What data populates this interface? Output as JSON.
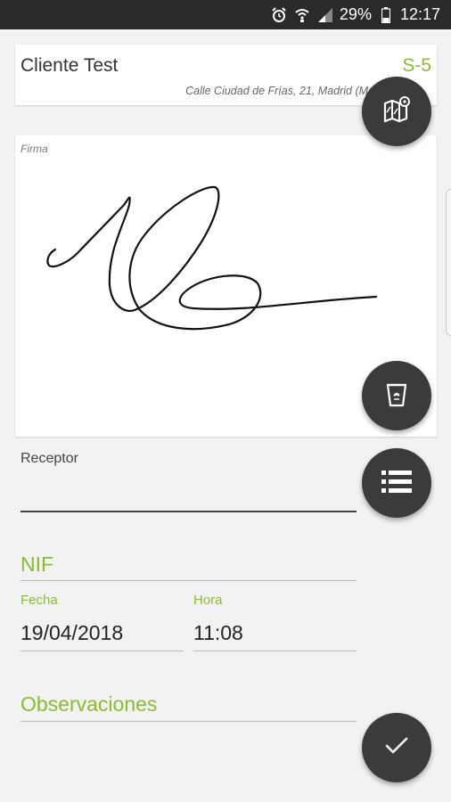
{
  "status_bar": {
    "battery": "29%",
    "time": "12:17",
    "icons": [
      "alarm-icon",
      "wifi-icon",
      "signal-icon",
      "battery-icon"
    ]
  },
  "client": {
    "name": "Cliente Test",
    "code": "S-5",
    "address": "Calle Ciudad de Frías, 21, Madrid (Ma"
  },
  "signature": {
    "label": "Firma"
  },
  "receptor": {
    "label": "Receptor",
    "value": ""
  },
  "nif": {
    "placeholder": "NIF",
    "value": ""
  },
  "fecha": {
    "label": "Fecha",
    "value": "19/04/2018"
  },
  "hora": {
    "label": "Hora",
    "value": "11:08"
  },
  "observaciones": {
    "placeholder": "Observaciones",
    "value": ""
  },
  "fabs": [
    "map-icon",
    "trash-icon",
    "list-icon",
    "check-icon"
  ],
  "colors": {
    "accent": "#8dbb2e",
    "fab": "#3b3b3b",
    "statusbar": "#2a2a2a"
  }
}
